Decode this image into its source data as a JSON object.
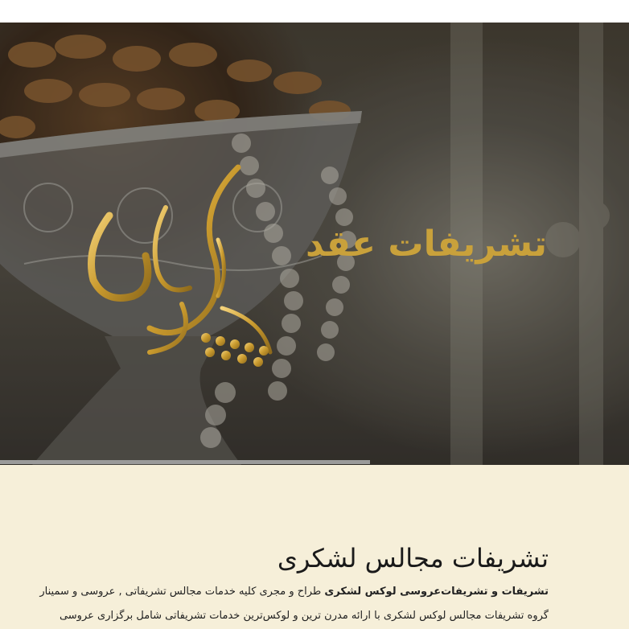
{
  "hero": {
    "title": "تشریفات عقد",
    "logo_text": "پیام لشکری",
    "accent_color": "#c9a13b"
  },
  "section": {
    "title": "تشریفات مجالس لشکری",
    "para1_bold": "تشریفات و تشریفات‌عروسی لوکس لشکری",
    "para1_text": " طراح و مجری کلیه خدمات مجالس تشریفاتی , عروسی و سمینار",
    "para2_text": "گروه تشریفات مجالس لوکس لشکری با ارائه مدرن ترین و لوکس‌ترین خدمات تشریفاتی شامل برگزاری عروسی"
  }
}
